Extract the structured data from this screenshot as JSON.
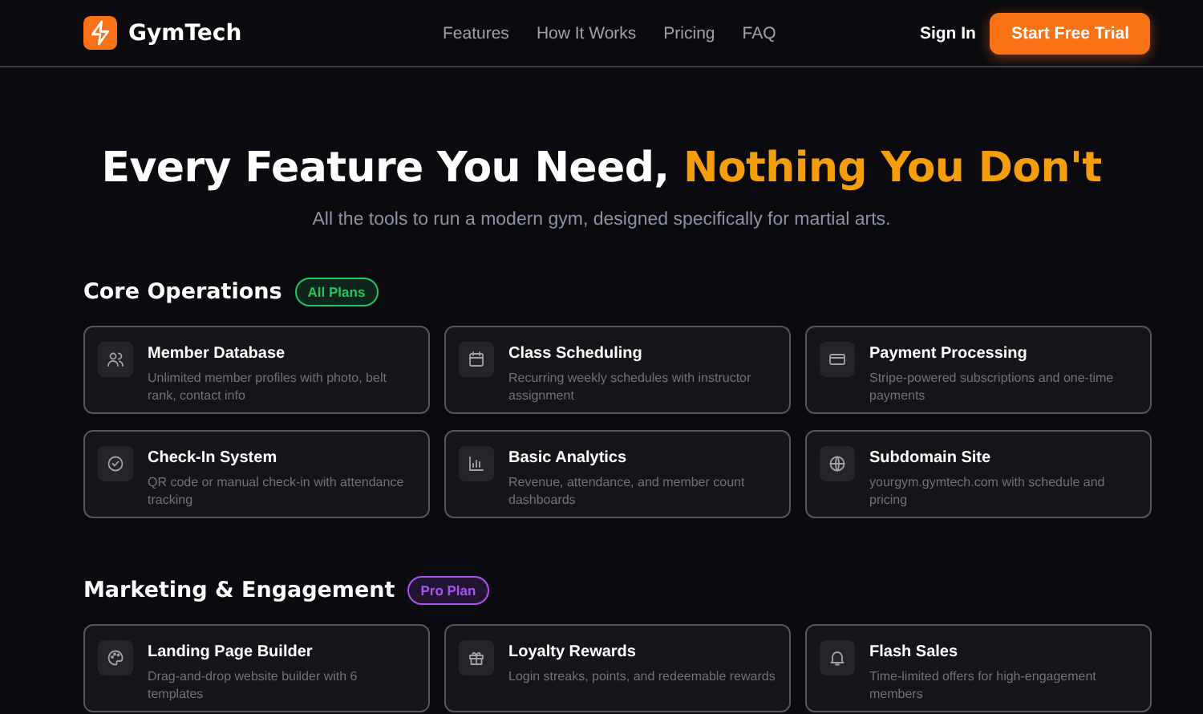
{
  "nav": {
    "brand": "GymTech",
    "links": [
      "Features",
      "How It Works",
      "Pricing",
      "FAQ"
    ],
    "sign_in": "Sign In",
    "cta": "Start Free Trial"
  },
  "hero": {
    "title": "Every Feature You Need, ",
    "highlight": "Nothing You Don't",
    "subtitle": "All the tools to run a modern gym, designed specifically for martial arts."
  },
  "sections": [
    {
      "title": "Core Operations",
      "badge": "All Plans",
      "color": "#22c55e",
      "features": [
        {
          "kind": "users",
          "title": "Member Database",
          "text": "Unlimited member profiles with photo, belt rank, contact info"
        },
        {
          "kind": "calendar",
          "title": "Class Scheduling",
          "text": "Recurring weekly schedules with instructor assignment"
        },
        {
          "kind": "card",
          "title": "Payment Processing",
          "text": "Stripe-powered subscriptions and one-time payments"
        },
        {
          "kind": "check",
          "title": "Check-In System",
          "text": "QR code or manual check-in with attendance tracking"
        },
        {
          "kind": "chart",
          "title": "Basic Analytics",
          "text": "Revenue, attendance, and member count dashboards"
        },
        {
          "kind": "globe",
          "title": "Subdomain Site",
          "text": "yourgym.gymtech.com with schedule and pricing"
        }
      ]
    },
    {
      "title": "Marketing & Engagement",
      "badge": "Pro Plan",
      "color": "#a855f7",
      "features": [
        {
          "kind": "palette",
          "title": "Landing Page Builder",
          "text": "Drag-and-drop website builder with 6 templates"
        },
        {
          "kind": "gift",
          "title": "Loyalty Rewards",
          "text": "Login streaks, points, and redeemable rewards"
        },
        {
          "kind": "bell",
          "title": "Flash Sales",
          "text": "Time-limited offers for high-engagement members"
        }
      ]
    }
  ]
}
